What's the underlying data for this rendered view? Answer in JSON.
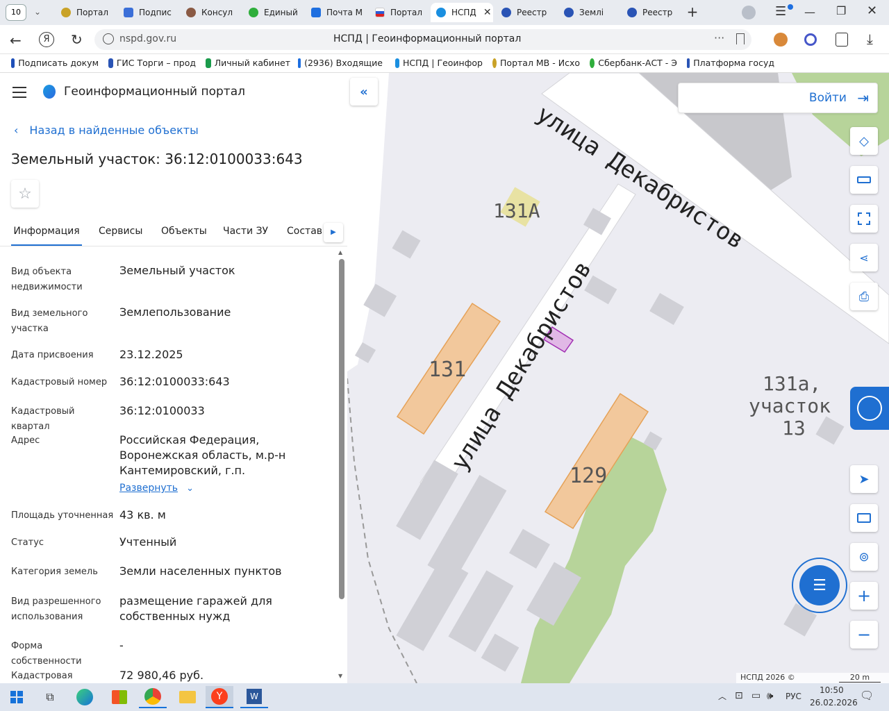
{
  "browser": {
    "tab_count": "10",
    "tabs": [
      {
        "label": "Портал",
        "color": "#c9a227"
      },
      {
        "label": "Подпис",
        "color": "#3b6fd8"
      },
      {
        "label": "Консул",
        "color": "#8a5a44"
      },
      {
        "label": "Единый",
        "color": "#2fae3c"
      },
      {
        "label": "Почта М",
        "color": "#1e6fe0"
      },
      {
        "label": "Портал",
        "color": "#d22"
      },
      {
        "label": "НСПД",
        "color": "#1a8fe0"
      },
      {
        "label": "Реестр",
        "color": "#2a54b5"
      },
      {
        "label": "Землі",
        "color": "#2a54b5"
      },
      {
        "label": "Реестр",
        "color": "#2a54b5"
      }
    ],
    "url": "nspd.gov.ru",
    "page_title": "НСПД | Геоинформационный портал",
    "bookmarks": [
      "Подписать докум",
      "ГИС Торги – прод",
      "Личный кабинет",
      "(2936) Входящие",
      "НСПД | Геоинфор",
      "Портал МВ - Исхо",
      "Сбербанк-АСТ - Э",
      "Платформа госуд"
    ]
  },
  "panel": {
    "app_title": "Геоинформационный портал",
    "back_link": "Назад в найденные объекты",
    "object_title": "Земельный участок: 36:12:0100033:643",
    "tabs": [
      "Информация",
      "Сервисы",
      "Объекты",
      "Части ЗУ",
      "Состав"
    ],
    "rows": [
      {
        "label": "Вид объекта недвижимости",
        "value": "Земельный участок"
      },
      {
        "label": "Вид земельного участка",
        "value": "Землепользование"
      },
      {
        "label": "Дата присвоения",
        "value": "23.12.2025"
      },
      {
        "label": "Кадастровый номер",
        "value": "36:12:0100033:643"
      },
      {
        "label": "Кадастровый квартал",
        "value": "36:12:0100033"
      },
      {
        "label": "Адрес",
        "value": "Российская Федерация, Воронежская область, м.р-н Кантемировский, г.п."
      },
      {
        "label": "Площадь уточненная",
        "value": "43 кв. м"
      },
      {
        "label": "Статус",
        "value": "Учтенный"
      },
      {
        "label": "Категория земель",
        "value": "Земли населенных пунктов"
      },
      {
        "label": "Вид разрешенного использования",
        "value": "размещение гаражей для собственных нужд"
      },
      {
        "label": "Форма собственности",
        "value": "-"
      },
      {
        "label": "Кадастровая",
        "value": "72 980,46 руб."
      }
    ],
    "expand_link": "Развернуть"
  },
  "map": {
    "login": "Войти",
    "street_top": "улица Декабристов",
    "street_diag": "улица Декабристов",
    "labels": {
      "l131a_top": "131А",
      "l131": "131",
      "l129": "129",
      "l131a_line1": "131а,",
      "l131a_line2": "участок",
      "l131a_line3": "13"
    },
    "footer": "НСПД 2026 ©",
    "scale": "20 m"
  },
  "taskbar": {
    "lang": "РУС",
    "time": "10:50",
    "date": "26.02.2026"
  }
}
